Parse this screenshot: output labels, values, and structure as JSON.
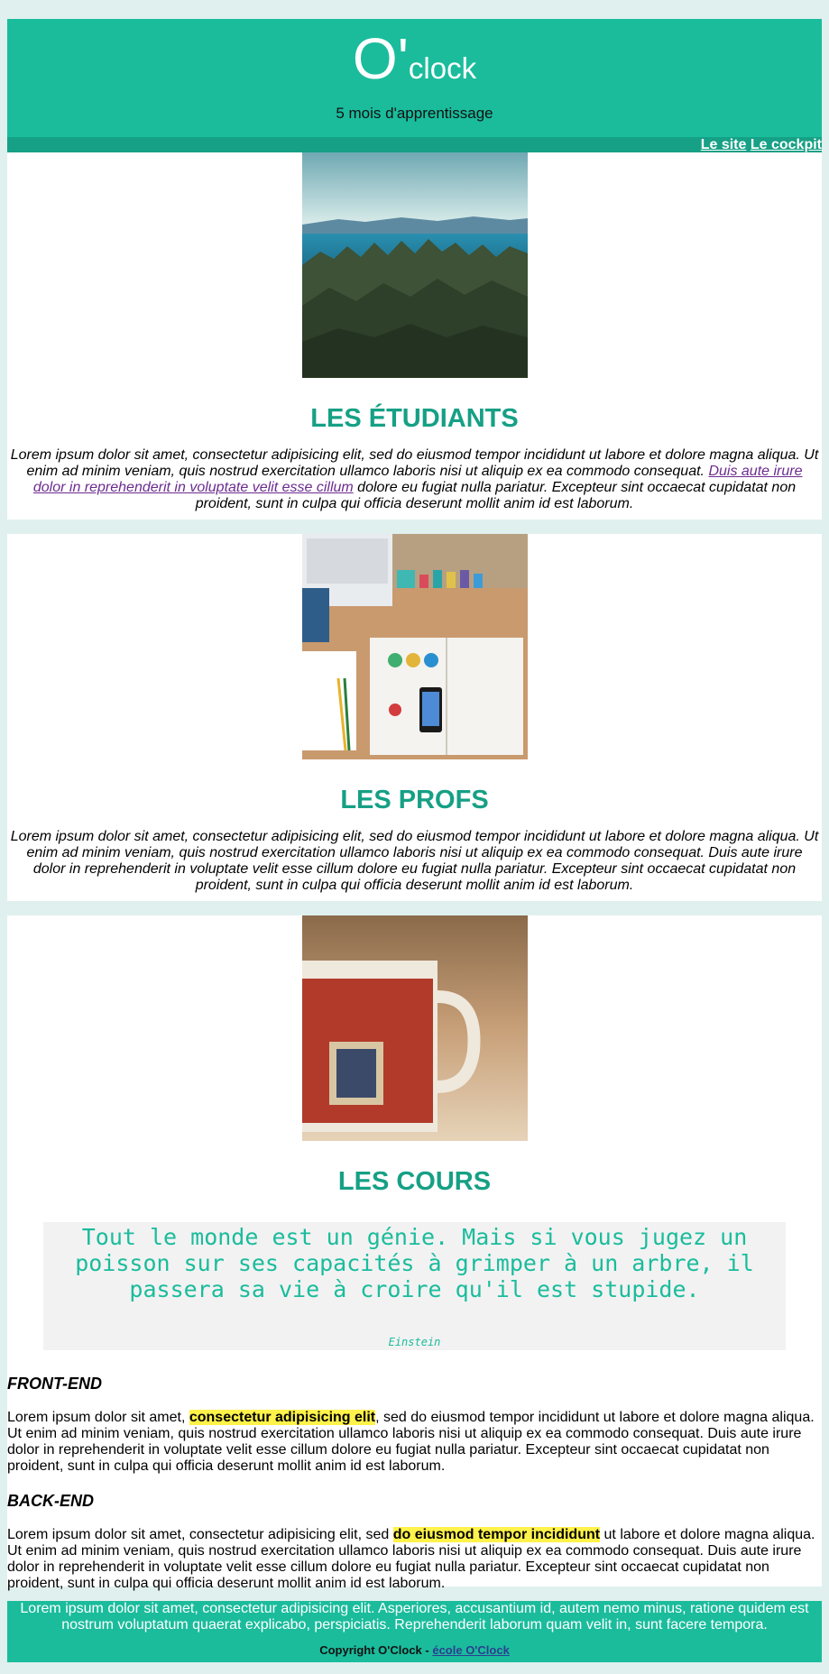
{
  "header": {
    "logo_big": "O'",
    "logo_small": "clock",
    "tagline": "5 mois d'apprentissage"
  },
  "nav": {
    "items": [
      {
        "label": "Le site"
      },
      {
        "label": "Le cockpit"
      }
    ]
  },
  "sections": [
    {
      "title": "LES ÉTUDIANTS",
      "image": "mountain-forest-image",
      "text_a": "Lorem ipsum dolor sit amet, consectetur adipisicing elit, sed do eiusmod tempor incididunt ut labore et dolore magna aliqua. Ut enim ad minim veniam, quis nostrud exercitation ullamco laboris nisi ut aliquip ex ea commodo consequat. ",
      "link": "Duis aute irure dolor in reprehenderit in voluptate velit esse cillum",
      "text_b": " dolore eu fugiat nulla pariatur. Excepteur sint occaecat cupidatat non proident, sunt in culpa qui officia deserunt mollit anim id est laborum."
    },
    {
      "title": "LES PROFS",
      "image": "desk-books-image",
      "text": "Lorem ipsum dolor sit amet, consectetur adipisicing elit, sed do eiusmod tempor incididunt ut labore et dolore magna aliqua. Ut enim ad minim veniam, quis nostrud exercitation ullamco laboris nisi ut aliquip ex ea commodo consequat. Duis aute irure dolor in reprehenderit in voluptate velit esse cillum dolore eu fugiat nulla pariatur. Excepteur sint occaecat cupidatat non proident, sunt in culpa qui officia deserunt mollit anim id est laborum."
    },
    {
      "title": "LES COURS",
      "image": "coffee-mug-image",
      "quote": "Tout le monde est un génie. Mais si vous jugez un poisson sur ses capacités à grimper à un arbre, il passera sa vie à croire qu'il est stupide.",
      "author": "Einstein",
      "front": {
        "title": "FRONT-END",
        "pre": "Lorem ipsum dolor sit amet, ",
        "highlight": "consectetur adipisicing elit",
        "post": ", sed do eiusmod tempor incididunt ut labore et dolore magna aliqua. Ut enim ad minim veniam, quis nostrud exercitation ullamco laboris nisi ut aliquip ex ea commodo consequat. Duis aute irure dolor in reprehenderit in voluptate velit esse cillum dolore eu fugiat nulla pariatur. Excepteur sint occaecat cupidatat non proident, sunt in culpa qui officia deserunt mollit anim id est laborum."
      },
      "back": {
        "title": "BACK-END",
        "pre": "Lorem ipsum dolor sit amet, consectetur adipisicing elit, sed ",
        "highlight": "do eiusmod tempor incididunt",
        "post": " ut labore et dolore magna aliqua. Ut enim ad minim veniam, quis nostrud exercitation ullamco laboris nisi ut aliquip ex ea commodo consequat. Duis aute irure dolor in reprehenderit in voluptate velit esse cillum dolore eu fugiat nulla pariatur. Excepteur sint occaecat cupidatat non proident, sunt in culpa qui officia deserunt mollit anim id est laborum."
      }
    }
  ],
  "footer": {
    "text": "Lorem ipsum dolor sit amet, consectetur adipisicing elit. Asperiores, accusantium id, autem nemo minus, ratione quidem est nostrum voluptatum quaerat explicabo, perspiciatis. Reprehenderit laborum quam velit in, sunt facere tempora.",
    "copyright": "Copyright O'Clock - ",
    "link": "école O'Clock"
  },
  "colors": {
    "accent": "#1abc9c",
    "accent_dark": "#16a085",
    "highlight": "#fff24a",
    "background": "#e0f0ee"
  }
}
